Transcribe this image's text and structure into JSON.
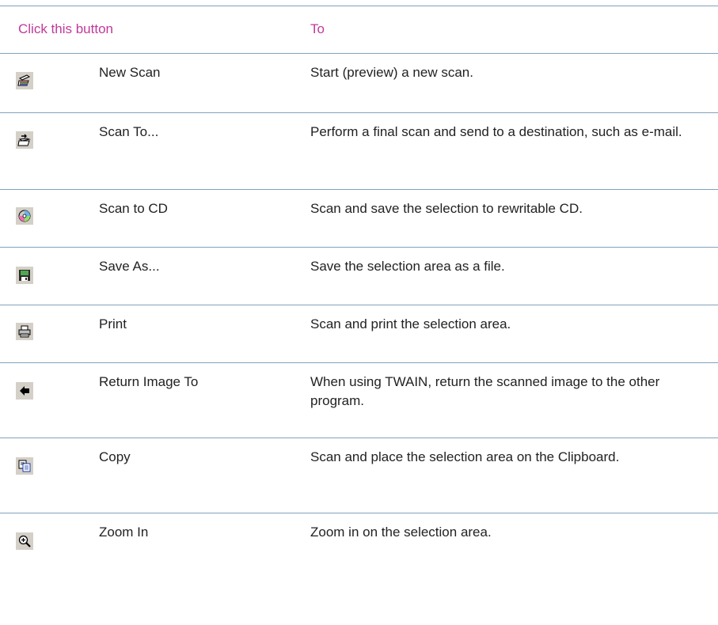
{
  "theme": {
    "header_color": "#c0399a",
    "rule_color": "#7fa3bd"
  },
  "header": {
    "col1": "Click this button",
    "col2": "To"
  },
  "rows": [
    {
      "icon": "scanner-new-scan-icon",
      "name": "New Scan",
      "desc": "Start (preview) a new scan."
    },
    {
      "icon": "scanner-scan-to-icon",
      "name": "Scan To...",
      "desc": "Perform a final scan and send to a destination, such as e-mail."
    },
    {
      "icon": "cd-icon",
      "name": "Scan to CD",
      "desc": "Scan and save the selection to rewritable CD."
    },
    {
      "icon": "floppy-save-icon",
      "name": "Save As...",
      "desc": "Save the selection area as a file."
    },
    {
      "icon": "printer-icon",
      "name": "Print",
      "desc": "Scan and print the selection area."
    },
    {
      "icon": "left-arrow-icon",
      "name": "Return Image To",
      "desc": "When using TWAIN, return the scanned image to the other program."
    },
    {
      "icon": "copy-icon",
      "name": "Copy",
      "desc": "Scan and place the selection area on the Clipboard."
    },
    {
      "icon": "zoom-in-icon",
      "name": "Zoom In",
      "desc": "Zoom in on the selection area."
    }
  ]
}
